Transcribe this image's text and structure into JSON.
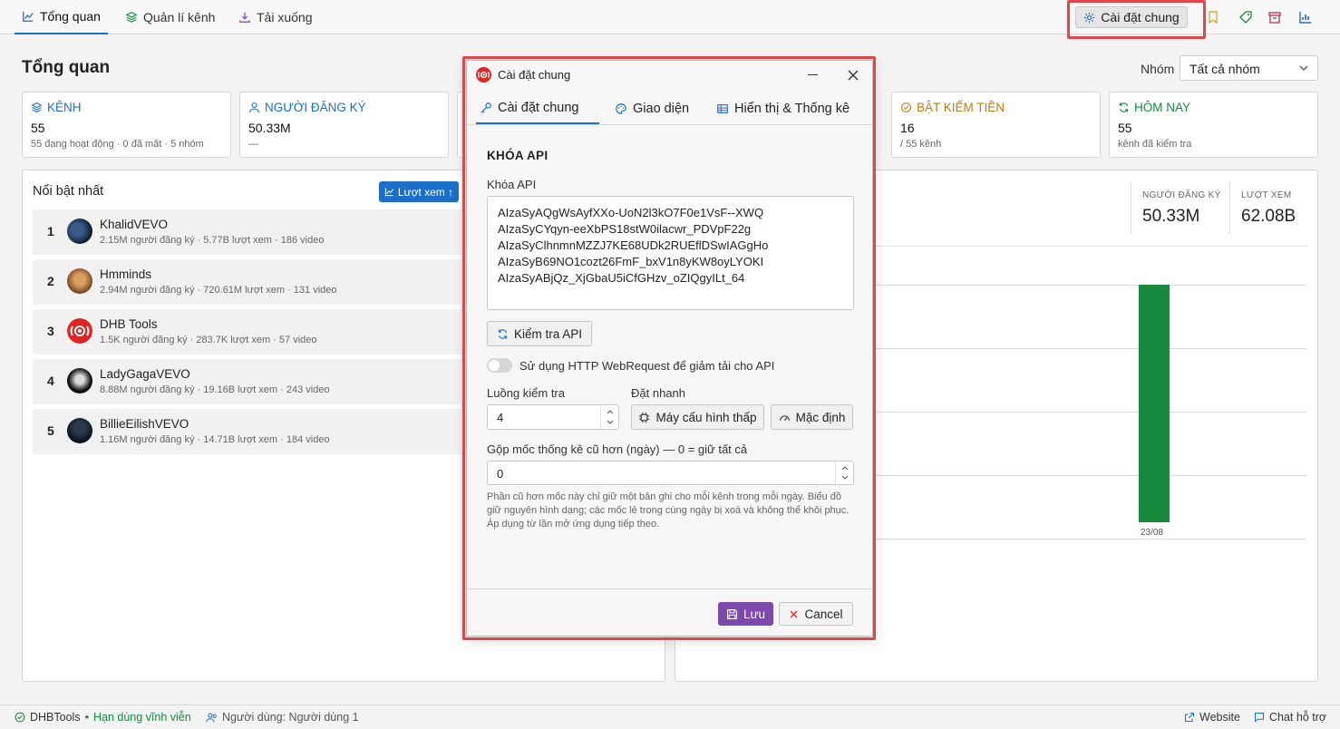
{
  "colors": {
    "accent": "#1b6fc9",
    "success": "#178a3e",
    "warning": "#c07a10",
    "save": "#7d49ad",
    "highlight": "#e0464a"
  },
  "nav": {
    "tabs": [
      {
        "label": "Tổng quan",
        "icon": "chart-line-icon"
      },
      {
        "label": "Quản lí kênh",
        "icon": "layers-icon"
      },
      {
        "label": "Tải xuống",
        "icon": "download-icon"
      }
    ],
    "settings_label": "Cài đặt chung"
  },
  "page": {
    "title": "Tổng quan",
    "group_label": "Nhóm",
    "group_value": "Tất cả nhóm"
  },
  "cards": [
    {
      "title": "KÊNH",
      "value": "55",
      "sub": "55 đang hoạt động · 0 đã mất · 5 nhóm"
    },
    {
      "title": "NGƯỜI ĐĂNG KÝ",
      "value": "50.33M",
      "sub": "—"
    },
    {
      "title": "BẬT KIẾM TIỀN",
      "value": "16",
      "sub": "/ 55 kênh"
    },
    {
      "title": "HÔM NAY",
      "value": "55",
      "sub": "kênh đã kiểm tra"
    }
  ],
  "top_panel": {
    "title": "Nổi bật nhất",
    "sort_label": "Lượt xem ↑",
    "rows": [
      {
        "rank": "1",
        "name": "KhalidVEVO",
        "meta": "2.15M người đăng ký · 5.77B lượt xem · 186 video"
      },
      {
        "rank": "2",
        "name": "Hmminds",
        "meta": "2.94M người đăng ký · 720.61M lượt xem · 131 video"
      },
      {
        "rank": "3",
        "name": "DHB Tools",
        "meta": "1.5K người đăng ký · 283.7K lượt xem · 57 video"
      },
      {
        "rank": "4",
        "name": "LadyGagaVEVO",
        "meta": "8.88M người đăng ký · 19.16B lượt xem · 243 video"
      },
      {
        "rank": "5",
        "name": "BillieEilishVEVO",
        "meta": "1.16M người đăng ký · 14.71B lượt xem · 184 video"
      }
    ]
  },
  "right_panel": {
    "subs_label": "NGƯỜI ĐĂNG KÝ",
    "subs_value": "50.33M",
    "views_label": "LƯỢT XEM",
    "views_value": "62.08B"
  },
  "chart_data": {
    "type": "bar",
    "categories": [
      "23/08"
    ],
    "values": [
      1
    ],
    "bar_fraction": 1.0,
    "title": "",
    "xlabel": "",
    "ylabel": ""
  },
  "dialog": {
    "title": "Cài đặt chung",
    "tabs": [
      "Cài đặt chung",
      "Giao diện",
      "Hiển thị & Thống kê"
    ],
    "section_title": "KHÓA API",
    "api_label": "Khóa API",
    "api_keys": [
      "AIzaSyAQgWsAyfXXo-UoN2l3kO7F0e1VsF--XWQ",
      "AIzaSyCYqyn-eeXbPS18stW0ilacwr_PDVpF22g",
      "AIzaSyClhnmnMZZJ7KE68UDk2RUEflDSwIAGgHo",
      "AIzaSyB69NO1cozt26FmF_bxV1n8yKW8oyLYOKI",
      "AIzaSyABjQz_XjGbaU5iCfGHzv_oZIQgyILt_64"
    ],
    "check_api_label": "Kiểm tra API",
    "http_toggle_label": "Sử dụng HTTP WebRequest để giảm tải cho API",
    "threads_label": "Luồng kiểm tra",
    "threads_value": "4",
    "quick_label": "Đặt nhanh",
    "low_config_label": "Máy cấu hình thấp",
    "default_label": "Mặc định",
    "merge_label": "Gộp mốc thống kê cũ hơn (ngày) — 0 = giữ tất cả",
    "merge_value": "0",
    "help_text": "Phần cũ hơn mốc này chỉ giữ một bản ghi cho mỗi kênh trong mỗi ngày. Biểu đồ giữ nguyên hình dạng; các mốc lẻ trong cùng ngày bị xoá và không thể khôi phục. Áp dụng từ lần mở ứng dụng tiếp theo.",
    "save_label": "Lưu",
    "cancel_label": "Cancel"
  },
  "statusbar": {
    "app_name": "DHBTools",
    "license": "Hạn dùng vĩnh viễn",
    "user": "Người dùng: Người dùng 1",
    "website": "Website",
    "support": "Chat hỗ trợ"
  }
}
